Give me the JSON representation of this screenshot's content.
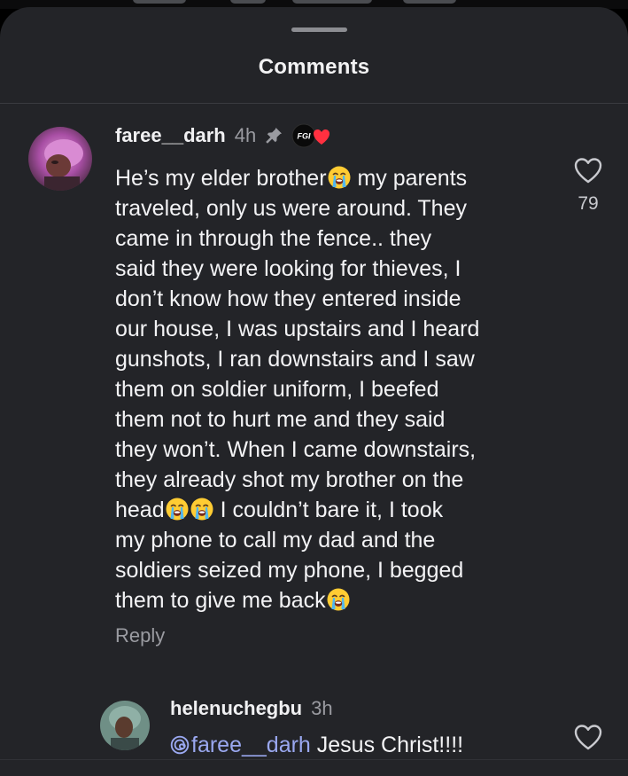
{
  "sheet": {
    "title": "Comments"
  },
  "comments": [
    {
      "username": "faree__darh",
      "time": "4h",
      "pinned": true,
      "badge_text": "FGI",
      "lines": [
        {
          "a": "He’s my elder brother",
          "e": 1,
          "b": " my parents"
        },
        {
          "a": "traveled, only us were around. They"
        },
        {
          "a": "came in through the fence.. they"
        },
        {
          "a": "said they were looking for thieves, I"
        },
        {
          "a": "don’t know how they entered inside"
        },
        {
          "a": "our house, I was upstairs and I heard"
        },
        {
          "a": "gunshots, I ran downstairs and I saw"
        },
        {
          "a": "them on soldier uniform, I beefed"
        },
        {
          "a": "them not to hurt me and they said"
        },
        {
          "a": "they won’t. When I came downstairs,"
        },
        {
          "a": "they already shot my brother on the"
        },
        {
          "a": "head",
          "e": 2,
          "b": " I couldn’t bare it, I took"
        },
        {
          "a": "my phone to call my dad and the"
        },
        {
          "a": "soldiers seized my phone, I begged"
        },
        {
          "a": "them to give me back",
          "e": 1,
          "b": ""
        }
      ],
      "reply_label": "Reply",
      "like_count": "79",
      "icons": {
        "like": "heart-outline-icon",
        "pin": "pin-icon",
        "emoji": "loudly-crying-face-emoji"
      }
    },
    {
      "username": "helenuchegbu",
      "time": "3h",
      "mention": "faree__darh",
      "text": " Jesus Christ!!!!",
      "icons": {
        "like": "heart-outline-icon",
        "mention": "threads-at-icon"
      }
    }
  ],
  "colors": {
    "sheet_bg": "#232428",
    "text_primary": "#f3f3f5",
    "text_secondary": "#9a9ba1",
    "mention": "#9aa8f0"
  }
}
